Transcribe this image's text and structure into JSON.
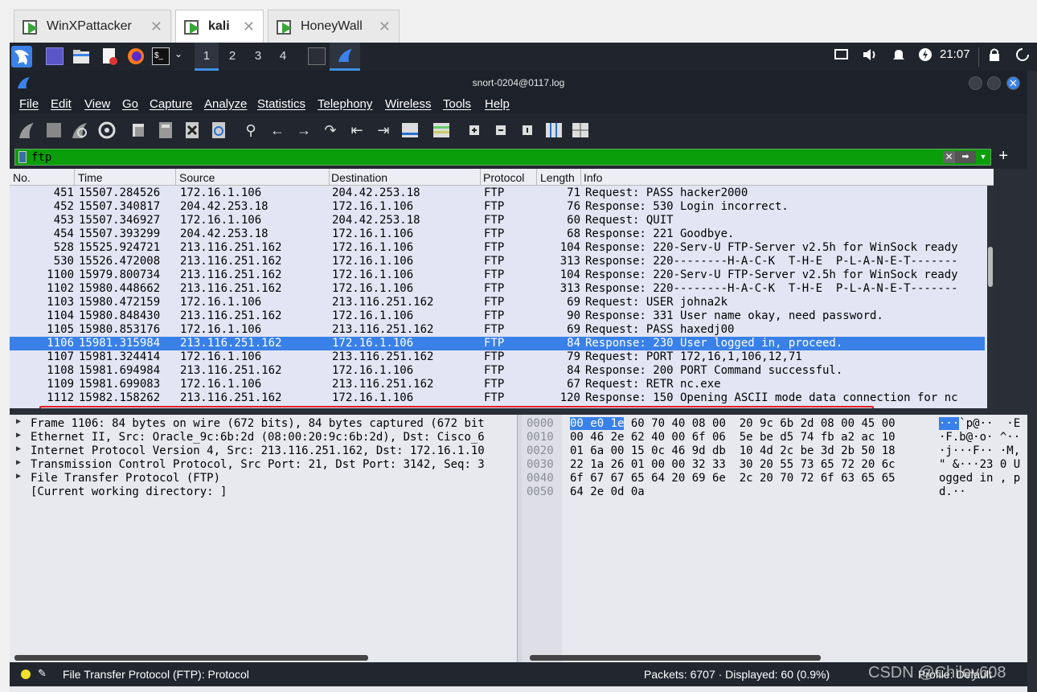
{
  "vm_tabs": [
    {
      "label": "WinXPattacker",
      "active": false
    },
    {
      "label": "kali",
      "active": true
    },
    {
      "label": "HoneyWall",
      "active": false
    }
  ],
  "panel": {
    "workspaces": [
      "1",
      "2",
      "3",
      "4"
    ],
    "active_workspace": "1",
    "clock": "21:07"
  },
  "window": {
    "title": "snort-0204@0117.log"
  },
  "menu": [
    "File",
    "Edit",
    "View",
    "Go",
    "Capture",
    "Analyze",
    "Statistics",
    "Telephony",
    "Wireless",
    "Tools",
    "Help"
  ],
  "filter": {
    "value": "ftp"
  },
  "columns": [
    "No.",
    "Time",
    "Source",
    "Destination",
    "Protocol",
    "Length",
    "Info"
  ],
  "packets": [
    {
      "no": "451",
      "time": "15507.284526",
      "src": "172.16.1.106",
      "dst": "204.42.253.18",
      "proto": "FTP",
      "len": "71",
      "info": "Request: PASS hacker2000"
    },
    {
      "no": "452",
      "time": "15507.340817",
      "src": "204.42.253.18",
      "dst": "172.16.1.106",
      "proto": "FTP",
      "len": "76",
      "info": "Response: 530 Login incorrect."
    },
    {
      "no": "453",
      "time": "15507.346927",
      "src": "172.16.1.106",
      "dst": "204.42.253.18",
      "proto": "FTP",
      "len": "60",
      "info": "Request: QUIT"
    },
    {
      "no": "454",
      "time": "15507.393299",
      "src": "204.42.253.18",
      "dst": "172.16.1.106",
      "proto": "FTP",
      "len": "68",
      "info": "Response: 221 Goodbye."
    },
    {
      "no": "528",
      "time": "15525.924721",
      "src": "213.116.251.162",
      "dst": "172.16.1.106",
      "proto": "FTP",
      "len": "104",
      "info": "Response: 220-Serv-U FTP-Server v2.5h for WinSock ready"
    },
    {
      "no": "530",
      "time": "15526.472008",
      "src": "213.116.251.162",
      "dst": "172.16.1.106",
      "proto": "FTP",
      "len": "313",
      "info": "Response: 220--------H-A-C-K  T-H-E  P-L-A-N-E-T-------"
    },
    {
      "no": "1100",
      "time": "15979.800734",
      "src": "213.116.251.162",
      "dst": "172.16.1.106",
      "proto": "FTP",
      "len": "104",
      "info": "Response: 220-Serv-U FTP-Server v2.5h for WinSock ready"
    },
    {
      "no": "1102",
      "time": "15980.448662",
      "src": "213.116.251.162",
      "dst": "172.16.1.106",
      "proto": "FTP",
      "len": "313",
      "info": "Response: 220--------H-A-C-K  T-H-E  P-L-A-N-E-T-------"
    },
    {
      "no": "1103",
      "time": "15980.472159",
      "src": "172.16.1.106",
      "dst": "213.116.251.162",
      "proto": "FTP",
      "len": "69",
      "info": "Request: USER johna2k"
    },
    {
      "no": "1104",
      "time": "15980.848430",
      "src": "213.116.251.162",
      "dst": "172.16.1.106",
      "proto": "FTP",
      "len": "90",
      "info": "Response: 331 User name okay, need password."
    },
    {
      "no": "1105",
      "time": "15980.853176",
      "src": "172.16.1.106",
      "dst": "213.116.251.162",
      "proto": "FTP",
      "len": "69",
      "info": "Request: PASS haxedj00"
    },
    {
      "no": "1106",
      "time": "15981.315984",
      "src": "213.116.251.162",
      "dst": "172.16.1.106",
      "proto": "FTP",
      "len": "84",
      "info": "Response: 230 User logged in, proceed."
    },
    {
      "no": "1107",
      "time": "15981.324414",
      "src": "172.16.1.106",
      "dst": "213.116.251.162",
      "proto": "FTP",
      "len": "79",
      "info": "Request: PORT 172,16,1,106,12,71"
    },
    {
      "no": "1108",
      "time": "15981.694984",
      "src": "213.116.251.162",
      "dst": "172.16.1.106",
      "proto": "FTP",
      "len": "84",
      "info": "Response: 200 PORT Command successful."
    },
    {
      "no": "1109",
      "time": "15981.699083",
      "src": "172.16.1.106",
      "dst": "213.116.251.162",
      "proto": "FTP",
      "len": "67",
      "info": "Request: RETR nc.exe"
    },
    {
      "no": "1112",
      "time": "15982.158262",
      "src": "213.116.251.162",
      "dst": "172.16.1.106",
      "proto": "FTP",
      "len": "120",
      "info": "Response: 150 Opening ASCII mode data connection for nc"
    }
  ],
  "selected_packet": "1106",
  "details": [
    {
      "text": "Frame 1106: 84 bytes on wire (672 bits), 84 bytes captured (672 bit",
      "expandable": true
    },
    {
      "text": "Ethernet II, Src: Oracle_9c:6b:2d (08:00:20:9c:6b:2d), Dst: Cisco_6",
      "expandable": true
    },
    {
      "text": "Internet Protocol Version 4, Src: 213.116.251.162, Dst: 172.16.1.10",
      "expandable": true
    },
    {
      "text": "Transmission Control Protocol, Src Port: 21, Dst Port: 3142, Seq: 3",
      "expandable": true
    },
    {
      "text": "File Transfer Protocol (FTP)",
      "expandable": true
    },
    {
      "text": "[Current working directory: ]",
      "expandable": false
    }
  ],
  "bytes": {
    "offsets": [
      "0000",
      "0010",
      "0020",
      "0030",
      "0040",
      "0050"
    ],
    "hex_first_highlight": "00 e0 1e",
    "hex": [
      " 60 70 40 08 00  20 9c 6b 2d 08 00 45 00",
      "00 46 2e 62 40 00 6f 06  5e be d5 74 fb a2 ac 10",
      "01 6a 00 15 0c 46 9d db  10 4d 2c be 3d 2b 50 18",
      "22 1a 26 01 00 00 32 33  30 20 55 73 65 72 20 6c",
      "6f 67 67 65 64 20 69 6e  2c 20 70 72 6f 63 65 65",
      "64 2e 0d 0a"
    ],
    "ascii_first_highlight": "···",
    "ascii": [
      "`p@··  ·E",
      "·F.b@·o· ^··",
      "·j···F·· ·M,",
      "\" &···23 0 U",
      "ogged in , p",
      "d.··"
    ]
  },
  "status": {
    "field": "File Transfer Protocol (FTP): Protocol",
    "packets": "Packets: 6707 · Displayed: 60 (0.9%)",
    "profile": "Profile: Default"
  },
  "watermark": "CSDN @Chiley608"
}
